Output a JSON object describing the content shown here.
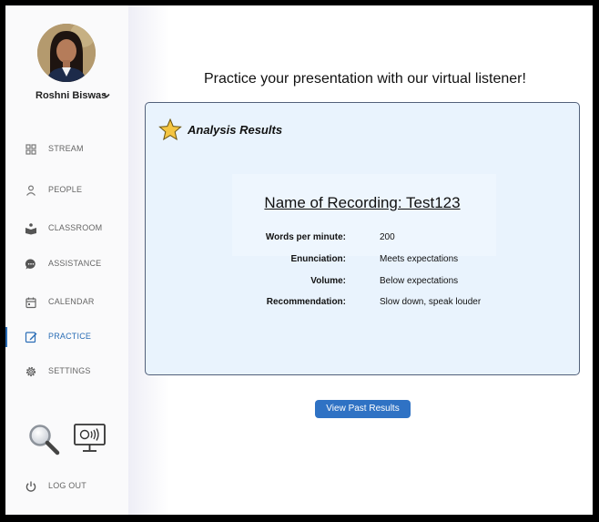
{
  "user": {
    "name": "Roshni Biswas"
  },
  "nav": {
    "stream": "STREAM",
    "people": "PEOPLE",
    "classroom": "CLASSROOM",
    "assistance": "ASSISTANCE",
    "calendar": "CALENDAR",
    "practice": "PRACTICE",
    "settings": "SETTINGS",
    "logout": "LOG OUT",
    "active": "PRACTICE"
  },
  "main": {
    "title": "Practice your presentation with our virtual listener!",
    "card_title": "Analysis Results",
    "recording_name": "Name of Recording: Test123",
    "metrics": [
      {
        "label": "Words per minute:",
        "value": "200"
      },
      {
        "label": "Enunciation:",
        "value": "Meets expectations"
      },
      {
        "label": "Volume:",
        "value": "Below expectations"
      },
      {
        "label": "Recommendation:",
        "value": "Slow down, speak louder"
      }
    ],
    "past_results_button": "View Past Results"
  },
  "icons": {
    "star": "star-icon",
    "magnifier": "magnifier-icon",
    "speaking_monitor": "speaking-monitor-icon"
  },
  "colors": {
    "accent": "#2a6db6",
    "button": "#2f72c4",
    "card_background": "#e9f3fd",
    "sidebar_background": "#fafafb"
  }
}
